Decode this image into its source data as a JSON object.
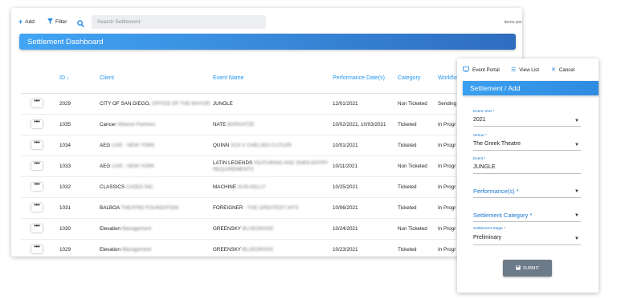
{
  "toolbar": {
    "add_label": "Add",
    "filter_label": "Filter",
    "search_placeholder": "Search Settlement",
    "items_per_page_label": "items per"
  },
  "dashboard": {
    "title": "Settlement Dashboard"
  },
  "table": {
    "columns": [
      "ID",
      "Client",
      "Event Name",
      "Performance Date(s)",
      "Category",
      "Workflow"
    ],
    "sort_indicator": "↓",
    "rows": [
      {
        "action": "•••",
        "id": "2029",
        "client": "CITY OF SAN DIEGO,",
        "client_blurred": "OFFICE OF THE MAYOR",
        "event": "JUNGLE",
        "event_blurred": "",
        "event_line2": "",
        "date": "12/01/2021",
        "category": "Non Ticketed",
        "workflow": "Sending"
      },
      {
        "action": "•••",
        "id": "1035",
        "client": "Cancer",
        "client_blurred": "Alliance Partners",
        "event": "NATE",
        "event_blurred": "BARGATZE",
        "event_line2": "",
        "date": "10/02/2021, 10/03/2021",
        "category": "Ticketed",
        "workflow": "In Progr"
      },
      {
        "action": "•••",
        "id": "1034",
        "client": "AEG",
        "client_blurred": "LIVE - NEW YORK",
        "event": "QUINN",
        "event_blurred": "XCII X CHELSEA CUTLER",
        "event_line2": "",
        "date": "10/01/2021",
        "category": "Ticketed",
        "workflow": "In Progr"
      },
      {
        "action": "•••",
        "id": "1033",
        "client": "AEG",
        "client_blurred": "LIVE - NEW YORK",
        "event": "LATIN LEGENDS",
        "event_blurred": "FEATURING AND SHEN ENTRY",
        "event_line2": "REQUIREMENTS",
        "date": "10/11/2021",
        "category": "Non Ticketed",
        "workflow": "In Progr"
      },
      {
        "action": "•••",
        "id": "1032",
        "client": "CLASSICS",
        "client_blurred": "CASES INC",
        "event": "MACHINE",
        "event_blurred": "GUN KELLY",
        "event_line2": "",
        "date": "10/25/2021",
        "category": "Ticketed",
        "workflow": "In Progr"
      },
      {
        "action": "•••",
        "id": "1031",
        "client": "BALBOA",
        "client_blurred": "THEATRE FOUNDATION",
        "event": "FOREIGNER",
        "event_blurred": "- THE GREATEST HITS",
        "event_line2": "",
        "date": "10/06/2021",
        "category": "Ticketed",
        "workflow": "In Progr"
      },
      {
        "action": "•••",
        "id": "1030",
        "client": "Elevation",
        "client_blurred": "Management",
        "event": "GREENSKY",
        "event_blurred": "BLUEGRASS",
        "event_line2": "",
        "date": "10/24/2021",
        "category": "Non Ticketed",
        "workflow": "In Progr"
      },
      {
        "action": "•••",
        "id": "1029",
        "client": "Elevation",
        "client_blurred": "Management",
        "event": "GREENSKY",
        "event_blurred": "BLUEGRASS",
        "event_line2": "",
        "date": "10/23/2021",
        "category": "Ticketed",
        "workflow": "In Progr"
      }
    ]
  },
  "side_panel": {
    "event_portal_label": "Event Portal",
    "view_list_label": "View List",
    "cancel_label": "Cancel",
    "title": "Settlement / Add",
    "event_year_label": "Event Year *",
    "event_year_value": "2021",
    "venue_label": "Venue *",
    "venue_value": "The Greek Theatre",
    "event_label": "Event *",
    "event_value": "JUNGLE",
    "performances_label": "Performance(s) *",
    "settlement_category_label": "Settlement Category *",
    "settlement_stage_label": "Settlement Stage *",
    "settlement_stage_value": "Preliminary",
    "submit_label": "SUBMIT"
  },
  "colors": {
    "accent": "#2196f3",
    "header_gradient_start": "#42a5f5",
    "header_gradient_end": "#2f6dbf",
    "submit_button": "#6c7a89"
  }
}
